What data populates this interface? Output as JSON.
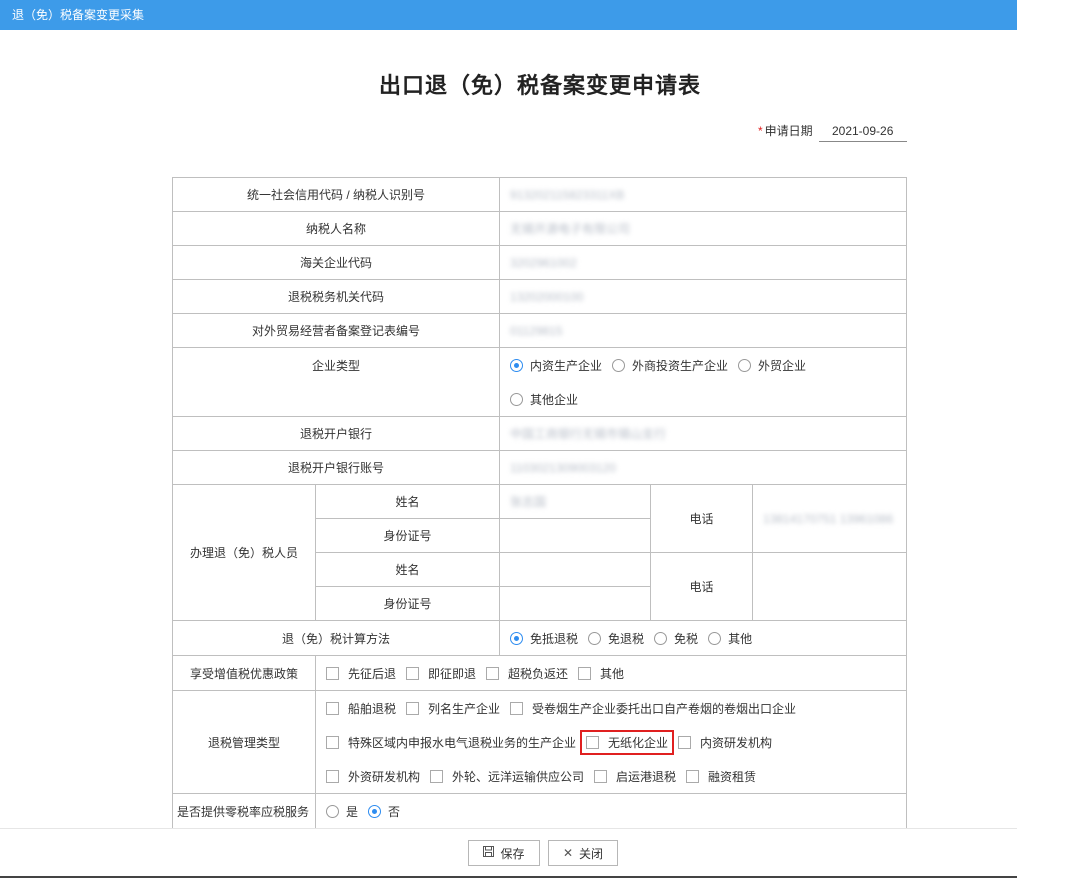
{
  "window": {
    "title": "退（免）税备案变更采集"
  },
  "form": {
    "title": "出口退（免）税备案变更申请表",
    "apply_date_label": "申请日期",
    "apply_date_value": "2021-09-26",
    "required_mark": "*"
  },
  "rows": {
    "credit_code": {
      "label": "统一社会信用代码 / 纳税人识别号",
      "value": "913202115823311XB"
    },
    "taxpayer_name": {
      "label": "纳税人名称",
      "value": "无锡开源电子有限公司"
    },
    "customs_code": {
      "label": "海关企业代码",
      "value": "3202961002"
    },
    "tax_office_code": {
      "label": "退税税务机关代码",
      "value": "13202000100"
    },
    "trade_reg_no": {
      "label": "对外贸易经营者备案登记表编号",
      "value": "01129815"
    },
    "enterprise_type": {
      "label": "企业类型",
      "options": [
        "内资生产企业",
        "外商投资生产企业",
        "外贸企业",
        "其他企业"
      ],
      "selected": "内资生产企业"
    },
    "bank": {
      "label": "退税开户银行",
      "value": "中国工商银行无锡市锡山支行"
    },
    "bank_account": {
      "label": "退税开户银行账号",
      "value": "1103021309003120"
    },
    "handler": {
      "label": "办理退（免）税人员",
      "name_label": "姓名",
      "id_label": "身份证号",
      "phone_label": "电话",
      "name1": "张志国",
      "phone1": "13814170751 13961086"
    },
    "calc_method": {
      "label": "退（免）税计算方法",
      "options": [
        "免抵退税",
        "免退税",
        "免税",
        "其他"
      ],
      "selected": "免抵退税"
    },
    "vat_policy": {
      "label": "享受增值税优惠政策",
      "options": [
        "先征后退",
        "即征即退",
        "超税负返还",
        "其他"
      ]
    },
    "mgmt_type": {
      "label": "退税管理类型",
      "line1": [
        "船舶退税",
        "列名生产企业",
        "受卷烟生产企业委托出口自产卷烟的卷烟出口企业"
      ],
      "line2": [
        "特殊区域内申报水电气退税业务的生产企业",
        "无纸化企业",
        "内资研发机构"
      ],
      "line3": [
        "外资研发机构",
        "外轮、远洋运输供应公司",
        "启运港退税",
        "融资租赁"
      ]
    },
    "zero_rate": {
      "label": "是否提供零税率应税服务",
      "options": [
        "是",
        "否"
      ],
      "selected": "否"
    }
  },
  "footer": {
    "save_label": "保存",
    "close_label": "关闭"
  }
}
